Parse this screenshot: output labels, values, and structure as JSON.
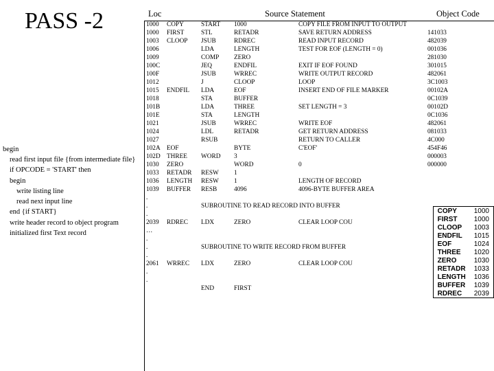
{
  "title": "PASS -2",
  "headers": {
    "loc": "Loc",
    "src": "Source Statement",
    "obj": "Object Code"
  },
  "pseudo": [
    {
      "t": "begin",
      "i": 0
    },
    {
      "t": "read first input file {from intermediate file}",
      "i": 1
    },
    {
      "t": "if OPCODE = 'START' then",
      "i": 1
    },
    {
      "t": "begin",
      "i": 1
    },
    {
      "t": "write listing line",
      "i": 2
    },
    {
      "t": "read next input line",
      "i": 2
    },
    {
      "t": "end {if START}",
      "i": 1
    },
    {
      "t": "write header record to object program",
      "i": 1
    },
    {
      "t": "initialized first Text record",
      "i": 1
    }
  ],
  "rows": [
    {
      "loc": "1000",
      "lbl": "COPY",
      "op": "START",
      "opn": "1000",
      "cmt": "COPY FILE FROM INPUT TO OUTPUT",
      "obj": ""
    },
    {
      "loc": "1000",
      "lbl": "FIRST",
      "op": "STL",
      "opn": "RETADR",
      "cmt": "SAVE RETURN ADDRESS",
      "obj": "141033"
    },
    {
      "loc": "1003",
      "lbl": "CLOOP",
      "op": "JSUB",
      "opn": "RDREC",
      "cmt": "READ INPUT RECORD",
      "obj": "482039"
    },
    {
      "loc": "1006",
      "lbl": "",
      "op": "LDA",
      "opn": "LENGTH",
      "cmt": "TEST FOR EOF (LENGTH = 0)",
      "obj": "001036"
    },
    {
      "loc": "1009",
      "lbl": "",
      "op": "COMP",
      "opn": "ZERO",
      "cmt": "",
      "obj": "281030"
    },
    {
      "loc": "100C",
      "lbl": "",
      "op": "JEQ",
      "opn": "ENDFIL",
      "cmt": "EXIT IF EOF FOUND",
      "obj": "301015"
    },
    {
      "loc": "100F",
      "lbl": "",
      "op": "JSUB",
      "opn": "WRREC",
      "cmt": "WRITE OUTPUT RECORD",
      "obj": "482061"
    },
    {
      "loc": "1012",
      "lbl": "",
      "op": "J",
      "opn": "CLOOP",
      "cmt": "LOOP",
      "obj": "3C1003"
    },
    {
      "loc": "1015",
      "lbl": "ENDFIL",
      "op": "LDA",
      "opn": "EOF",
      "cmt": "INSERT END OF FILE MARKER",
      "obj": "00102A"
    },
    {
      "loc": "1018",
      "lbl": "",
      "op": "STA",
      "opn": "BUFFER",
      "cmt": "",
      "obj": "0C1039"
    },
    {
      "loc": "101B",
      "lbl": "",
      "op": "LDA",
      "opn": "THREE",
      "cmt": "SET LENGTH = 3",
      "obj": "00102D"
    },
    {
      "loc": "101E",
      "lbl": "",
      "op": "STA",
      "opn": "LENGTH",
      "cmt": "",
      "obj": "0C1036"
    },
    {
      "loc": "1021",
      "lbl": "",
      "op": "JSUB",
      "opn": "WRREC",
      "cmt": "WRITE EOF",
      "obj": "482061"
    },
    {
      "loc": "1024",
      "lbl": "",
      "op": "LDL",
      "opn": "RETADR",
      "cmt": "GET RETURN   ADDRESS",
      "obj": "081033"
    },
    {
      "loc": "1027",
      "lbl": "",
      "op": "RSUB",
      "opn": "",
      "cmt": "RETURN TO CALLER",
      "obj": "4C000"
    },
    {
      "loc": "102A",
      "lbl": "EOF",
      "op": "",
      "opn": "BYTE",
      "cmt": "C'EOF'",
      "obj": "454F46"
    },
    {
      "loc": "102D",
      "lbl": "THREE",
      "op": "WORD",
      "opn": "3",
      "cmt": "",
      "obj": "000003"
    },
    {
      "loc": "1030",
      "lbl": "ZERO",
      "op": "",
      "opn": "WORD",
      "cmt": "0",
      "obj": "000000"
    },
    {
      "loc": "1033",
      "lbl": "RETADR",
      "op": "RESW",
      "opn": "1",
      "cmt": "",
      "obj": ""
    },
    {
      "loc": "1036",
      "lbl": "LENGTH",
      "op": "RESW",
      "opn": "1",
      "cmt": "LENGTH OF RECORD",
      "obj": ""
    },
    {
      "loc": "1039",
      "lbl": "BUFFER",
      "op": "RESB",
      "opn": "4096",
      "cmt": "4096-BYTE BUFFER AREA",
      "obj": ""
    },
    {
      "loc": ".",
      "lbl": "",
      "op": "",
      "opn": "",
      "cmt": "",
      "obj": ""
    },
    {
      "span": true,
      "loc": ".",
      "text": "SUBROUTINE TO READ RECORD INTO BUFFER"
    },
    {
      "loc": ".",
      "lbl": "",
      "op": "",
      "opn": "",
      "cmt": "",
      "obj": ""
    },
    {
      "loc": "2039",
      "lbl": "RDREC",
      "op": "LDX",
      "opn": "ZERO",
      "cmt": "CLEAR LOOP COU",
      "obj": ""
    },
    {
      "loc": "…",
      "lbl": "",
      "op": "",
      "opn": "",
      "cmt": "",
      "obj": ""
    },
    {
      "loc": ".",
      "lbl": "",
      "op": "",
      "opn": "",
      "cmt": "",
      "obj": ""
    },
    {
      "span": true,
      "loc": ".",
      "text": "SUBROUTINE TO WRITE RECORD FROM BUFFER"
    },
    {
      "loc": ".",
      "lbl": "",
      "op": "",
      "opn": "",
      "cmt": "",
      "obj": ""
    },
    {
      "loc": "2061",
      "lbl": "WRREC",
      "op": "LDX",
      "opn": "ZERO",
      "cmt": "CLEAR LOOP COU",
      "obj": ""
    },
    {
      "loc": ".",
      "lbl": "",
      "op": "",
      "opn": "",
      "cmt": "",
      "obj": ""
    },
    {
      "loc": ".",
      "lbl": "",
      "op": "",
      "opn": "",
      "cmt": "",
      "obj": ""
    },
    {
      "loc": "",
      "lbl": "",
      "op": "END",
      "opn": "FIRST",
      "cmt": "",
      "obj": ""
    }
  ],
  "sidebox": [
    {
      "l": "COPY",
      "v": "1000"
    },
    {
      "l": "FIRST",
      "v": "1000"
    },
    {
      "l": "CLOOP",
      "v": "1003"
    },
    {
      "l": "ENDFIL",
      "v": "1015"
    },
    {
      "l": "EOF",
      "v": "1024"
    },
    {
      "l": "THREE",
      "v": "1020"
    },
    {
      "l": "ZERO",
      "v": "1030"
    },
    {
      "l": "RETADR",
      "v": "1033"
    },
    {
      "l": "LENGTH",
      "v": "1036"
    },
    {
      "l": "BUFFER",
      "v": "1039"
    },
    {
      "l": "RDREC",
      "v": "2039"
    }
  ]
}
